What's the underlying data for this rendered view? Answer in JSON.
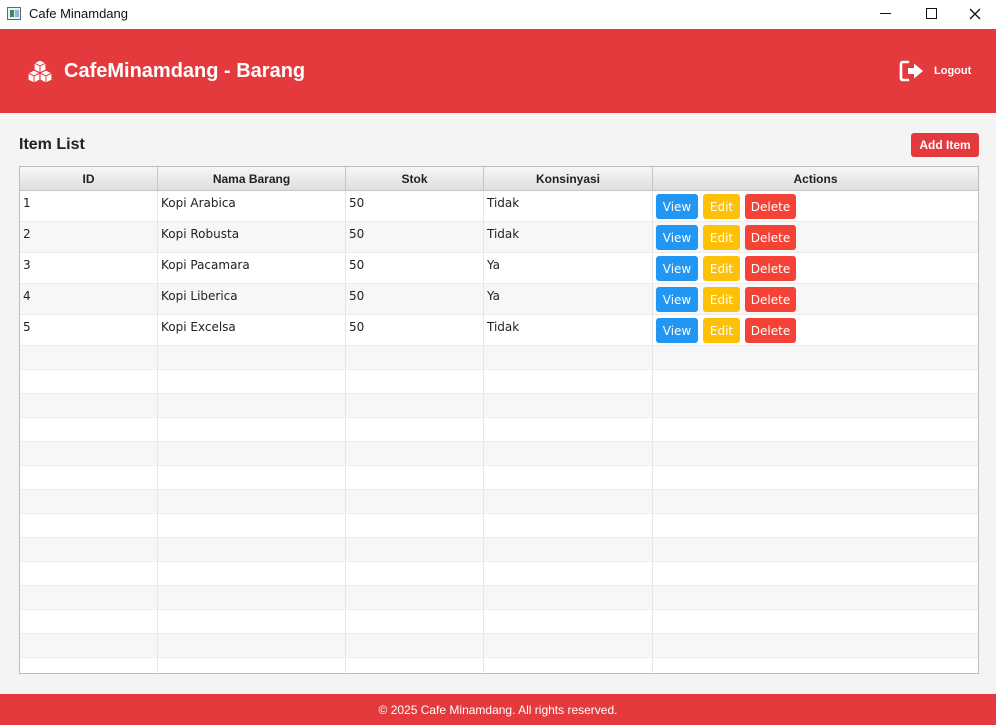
{
  "window": {
    "title": "Cafe Minamdang"
  },
  "header": {
    "title": "CafeMinamdang - Barang",
    "logout_label": "Logout"
  },
  "main": {
    "section_title": "Item List",
    "add_button_label": "Add Item",
    "table": {
      "columns": [
        "ID",
        "Nama Barang",
        "Stok",
        "Konsinyasi",
        "Actions"
      ],
      "rows": [
        {
          "id": "1",
          "nama": "Kopi Arabica",
          "stok": "50",
          "konsinyasi": "Tidak"
        },
        {
          "id": "2",
          "nama": "Kopi Robusta",
          "stok": "50",
          "konsinyasi": "Tidak"
        },
        {
          "id": "3",
          "nama": "Kopi Pacamara",
          "stok": "50",
          "konsinyasi": "Ya"
        },
        {
          "id": "4",
          "nama": "Kopi Liberica",
          "stok": "50",
          "konsinyasi": "Ya"
        },
        {
          "id": "5",
          "nama": "Kopi Excelsa",
          "stok": "50",
          "konsinyasi": "Tidak"
        }
      ],
      "action_labels": {
        "view": "View",
        "edit": "Edit",
        "delete": "Delete"
      }
    }
  },
  "footer": {
    "text": "© 2025 Cafe Minamdang. All rights reserved."
  },
  "colors": {
    "brand": "#e53a3d",
    "view": "#2196f3",
    "edit": "#ffc107",
    "delete": "#f44336"
  },
  "icons": {
    "logo": "cubes-icon",
    "logout": "sign-out-icon"
  }
}
